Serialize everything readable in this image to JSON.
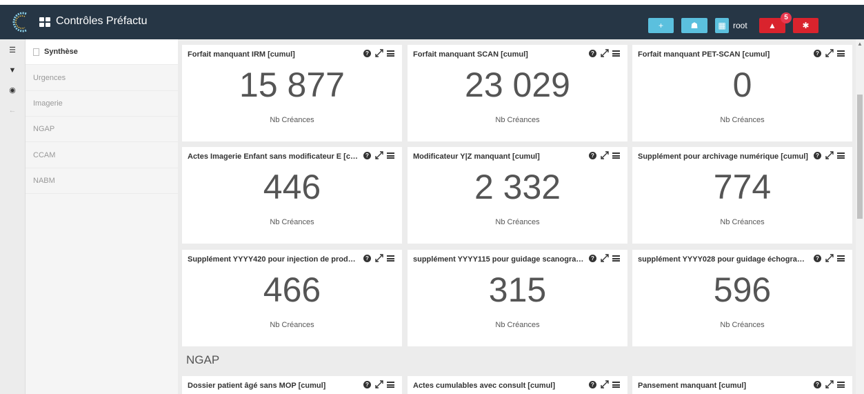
{
  "header": {
    "app_title": "Contrôles Préfactu",
    "user": "root",
    "notifications_count": "5",
    "buttons": [
      {
        "icon": "plus-icon",
        "glyph": "+"
      },
      {
        "icon": "users-icon",
        "glyph": "☗"
      },
      {
        "icon": "grid-icon",
        "glyph": "▦"
      }
    ],
    "colors": {
      "bar": "#263645",
      "info": "#5bc0de",
      "danger": "#d9232d"
    }
  },
  "rail": {
    "icons": [
      {
        "name": "list-icon",
        "glyph": "☰"
      },
      {
        "name": "filter-icon",
        "glyph": "▼"
      },
      {
        "name": "target-icon",
        "glyph": "◉"
      },
      {
        "name": "back-arrow-icon",
        "glyph": "←"
      }
    ]
  },
  "sidebar": {
    "items": [
      {
        "label": "Synthèse"
      },
      {
        "label": "Urgences"
      },
      {
        "label": "Imagerie"
      },
      {
        "label": "NGAP"
      },
      {
        "label": "CCAM"
      },
      {
        "label": "NABM"
      }
    ]
  },
  "widgets": [
    {
      "title": "Forfait manquant IRM [cumul]",
      "value": "15 877",
      "unit": "Nb Créances"
    },
    {
      "title": "Forfait manquant SCAN [cumul]",
      "value": "23 029",
      "unit": "Nb Créances"
    },
    {
      "title": "Forfait manquant PET-SCAN [cumul]",
      "value": "0",
      "unit": "Nb Créances"
    },
    {
      "title": "Actes Imagerie Enfant sans modificateur E [cu...",
      "value": "446",
      "unit": "Nb Créances"
    },
    {
      "title": "Modificateur Y|Z manquant [cumul]",
      "value": "2 332",
      "unit": "Nb Créances"
    },
    {
      "title": "Supplément pour archivage numérique [cumul]",
      "value": "774",
      "unit": "Nb Créances"
    },
    {
      "title": "Supplément YYYY420 pour injection de produit ...",
      "value": "466",
      "unit": "Nb Créances"
    },
    {
      "title": "supplément YYYY115 pour guidage scanograph...",
      "value": "315",
      "unit": "Nb Créances"
    },
    {
      "title": "supplément YYYY028 pour guidage échographi...",
      "value": "596",
      "unit": "Nb Créances"
    }
  ],
  "ngap_section": {
    "title": "NGAP",
    "widgets": [
      {
        "title": "Dossier patient âgé sans MOP [cumul]"
      },
      {
        "title": "Actes cumulables avec consult [cumul]"
      },
      {
        "title": "Pansement manquant [cumul]"
      }
    ]
  },
  "tools": {
    "help_glyph": "?"
  }
}
